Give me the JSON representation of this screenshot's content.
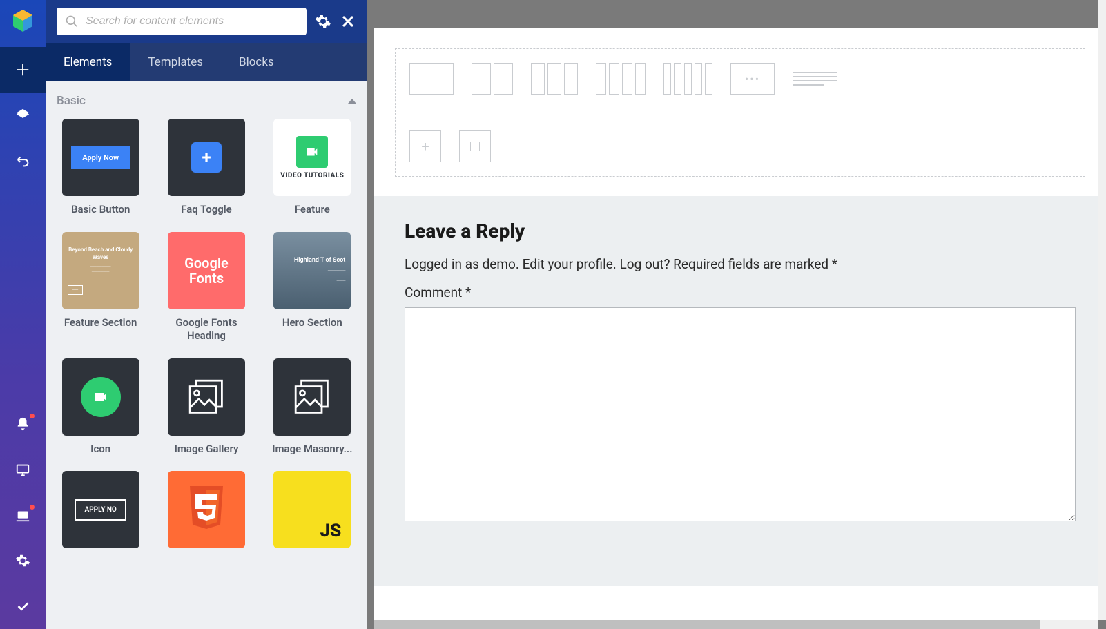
{
  "search": {
    "placeholder": "Search for content elements"
  },
  "tabs": {
    "elements": "Elements",
    "templates": "Templates",
    "blocks": "Blocks"
  },
  "section": {
    "basic": "Basic"
  },
  "cards": {
    "basic_button": "Basic Button",
    "basic_button_inner": "Apply Now",
    "faq_toggle": "Faq Toggle",
    "feature": "Feature",
    "feature_inner": "VIDEO TUTORIALS",
    "feature_section": "Feature Section",
    "feature_section_inner_title": "Beyond Beach and Cloudy Waves",
    "google_fonts": "Google Fonts Heading",
    "google_fonts_inner1": "Google",
    "google_fonts_inner2": "Fonts",
    "hero_section": "Hero Section",
    "hero_inner_title": "Highland T of Scot",
    "icon": "Icon",
    "image_gallery": "Image Gallery",
    "image_masonry": "Image Masonry...",
    "outline_inner": "APPLY NO",
    "js_inner": "JS"
  },
  "reply": {
    "heading": "Leave a Reply",
    "meta": "Logged in as demo. Edit your profile. Log out? Required fields are marked *",
    "comment_label": "Comment *"
  }
}
